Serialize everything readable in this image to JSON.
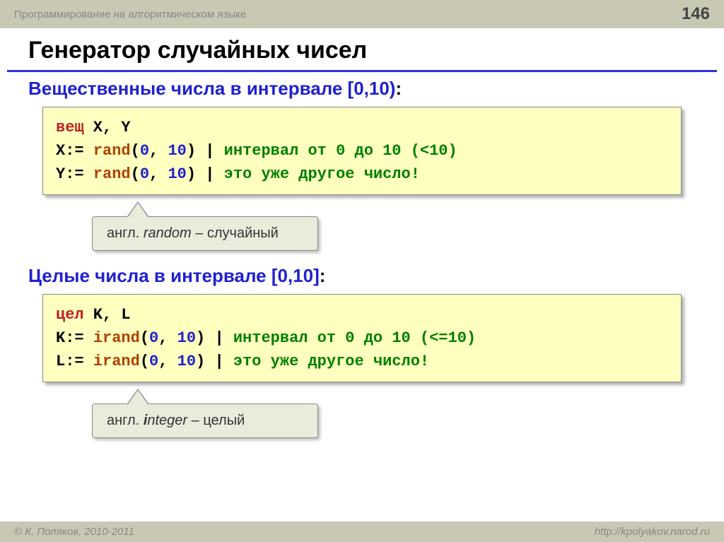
{
  "header": {
    "breadcrumb": "Программирование на алгоритмическом языке",
    "page_number": "146"
  },
  "title": "Генератор случайных чисел",
  "section1": {
    "title_part": "Вещественные числа в интервале [0,10)",
    "colon": ":",
    "code": {
      "line1": {
        "type": "вещ",
        "vars": " X, Y"
      },
      "line2": {
        "var": "X:= ",
        "func": "rand",
        "args_open": "(",
        "n1": "0",
        "sep": ", ",
        "n2": "10",
        "args_close": ")",
        "pipe": " | ",
        "comment": "интервал от 0 до 10 (<10)"
      },
      "line3": {
        "var": "Y:= ",
        "func": "rand",
        "args_open": "(",
        "n1": "0",
        "sep": ", ",
        "n2": "10",
        "args_close": ")",
        "pipe": " | ",
        "comment": "это уже другое число!"
      }
    },
    "note": {
      "prefix": "англ. ",
      "word": "random",
      "suffix": " – случайный"
    }
  },
  "section2": {
    "title_part": "Целые числа в интервале [0,10]",
    "colon": ":",
    "code": {
      "line1": {
        "type": "цел",
        "vars": " K, L"
      },
      "line2": {
        "var": "K:= ",
        "func": "irand",
        "args_open": "(",
        "n1": "0",
        "sep": ", ",
        "n2": "10",
        "args_close": ")",
        "pipe": " | ",
        "comment": "интервал от 0 до 10 (<=10)"
      },
      "line3": {
        "var": "L:= ",
        "func": "irand",
        "args_open": "(",
        "n1": "0",
        "sep": ", ",
        "n2": "10",
        "args_close": ")",
        "pipe": " | ",
        "comment": "это уже другое число!"
      }
    },
    "note": {
      "prefix": "англ. ",
      "bold": "i",
      "word": "nteger",
      "suffix": " – целый"
    }
  },
  "footer": {
    "copyright": "© К. Поляков, 2010-2011",
    "url": "http://kpolyakov.narod.ru"
  }
}
